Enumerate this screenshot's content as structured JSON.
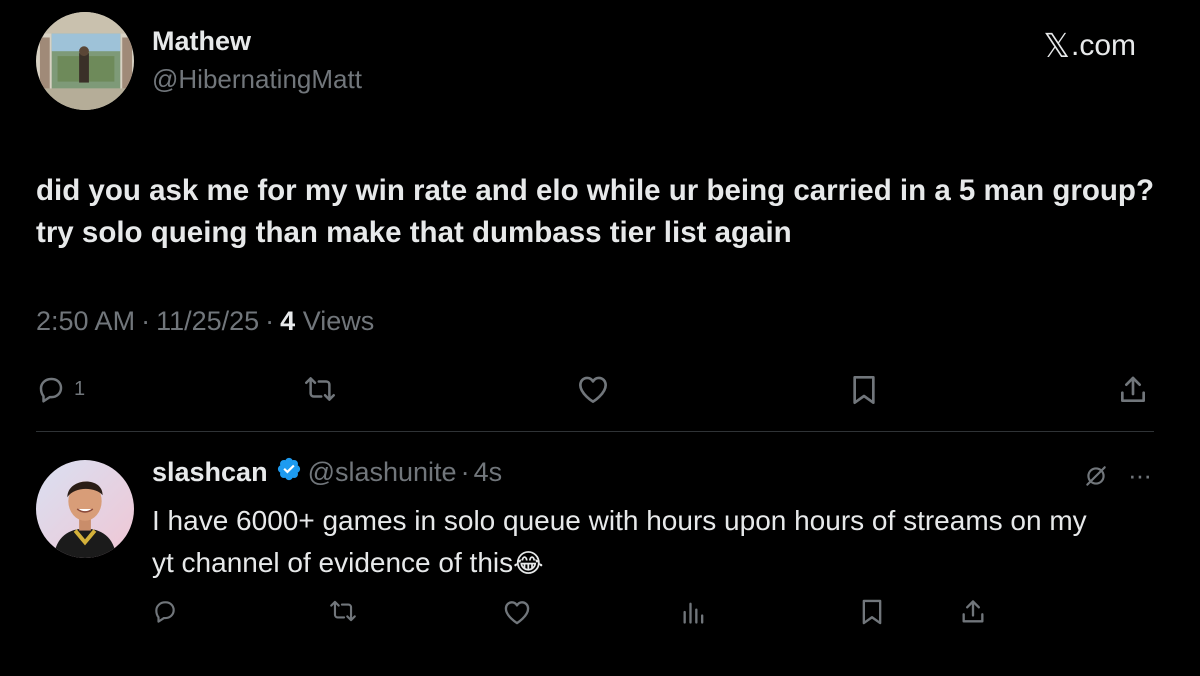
{
  "tweet": {
    "author": {
      "name": "Mathew",
      "handle": "@HibernatingMatt"
    },
    "brand": {
      "x_glyph": "𝕏",
      "suffix": ".com"
    },
    "text": "did you ask me for my win rate and elo while ur being carried in a 5 man group? try solo queing than make that dumbass tier list again",
    "meta": {
      "time": "2:50 AM",
      "separator": "·",
      "date": "11/25/25",
      "views_count": "4",
      "views_label": "Views"
    },
    "actions": {
      "reply_count": "1",
      "icons": [
        "reply-icon",
        "retweet-icon",
        "like-icon",
        "bookmark-icon",
        "share-icon"
      ]
    }
  },
  "reply": {
    "author": {
      "name": "slashcan",
      "handle": "@slashunite",
      "separator": "·",
      "time": "4s"
    },
    "text": "I have 6000+ games in solo queue with hours upon hours of streams on my yt channel of evidence of this",
    "emoji": "😂",
    "more": "···",
    "actions": {
      "icons": [
        "reply-icon",
        "retweet-icon",
        "like-icon",
        "analytics-icon",
        "bookmark-icon",
        "share-icon"
      ]
    }
  },
  "colors": {
    "background": "#000000",
    "text": "#e7e9ea",
    "secondary": "#71767b",
    "verified": "#1d9bf0",
    "divider": "#2f3336"
  }
}
